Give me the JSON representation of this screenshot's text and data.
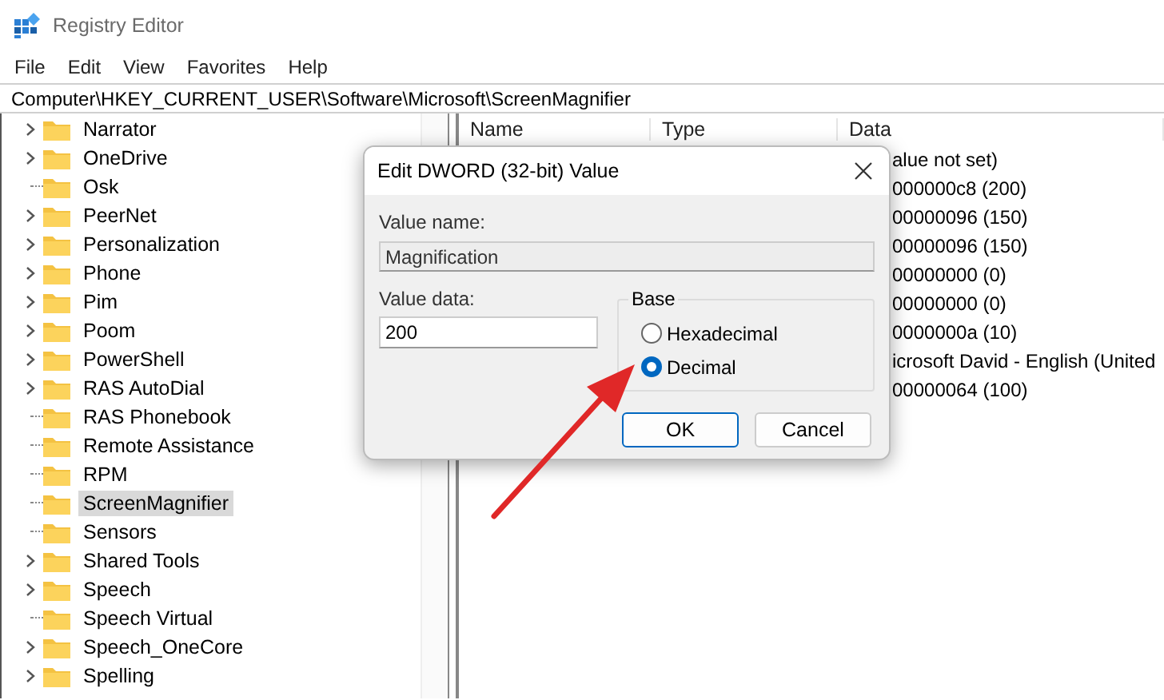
{
  "window": {
    "title": "Registry Editor"
  },
  "menu": [
    "File",
    "Edit",
    "View",
    "Favorites",
    "Help"
  ],
  "address": "Computer\\HKEY_CURRENT_USER\\Software\\Microsoft\\ScreenMagnifier",
  "tree": [
    {
      "label": "Narrator",
      "expandable": true,
      "selected": false
    },
    {
      "label": "OneDrive",
      "expandable": true,
      "selected": false
    },
    {
      "label": "Osk",
      "expandable": false,
      "selected": false
    },
    {
      "label": "PeerNet",
      "expandable": true,
      "selected": false
    },
    {
      "label": "Personalization",
      "expandable": true,
      "selected": false
    },
    {
      "label": "Phone",
      "expandable": true,
      "selected": false
    },
    {
      "label": "Pim",
      "expandable": true,
      "selected": false
    },
    {
      "label": "Poom",
      "expandable": true,
      "selected": false
    },
    {
      "label": "PowerShell",
      "expandable": true,
      "selected": false
    },
    {
      "label": "RAS AutoDial",
      "expandable": true,
      "selected": false
    },
    {
      "label": "RAS Phonebook",
      "expandable": false,
      "selected": false
    },
    {
      "label": "Remote Assistance",
      "expandable": false,
      "selected": false
    },
    {
      "label": "RPM",
      "expandable": false,
      "selected": false
    },
    {
      "label": "ScreenMagnifier",
      "expandable": false,
      "selected": true
    },
    {
      "label": "Sensors",
      "expandable": false,
      "selected": false
    },
    {
      "label": "Shared Tools",
      "expandable": true,
      "selected": false
    },
    {
      "label": "Speech",
      "expandable": true,
      "selected": false
    },
    {
      "label": "Speech Virtual",
      "expandable": false,
      "selected": false
    },
    {
      "label": "Speech_OneCore",
      "expandable": true,
      "selected": false
    },
    {
      "label": "Spelling",
      "expandable": true,
      "selected": false
    }
  ],
  "list": {
    "columns": [
      "Name",
      "Type",
      "Data"
    ],
    "rows": [
      {
        "data": "alue not set)"
      },
      {
        "data": "000000c8 (200)"
      },
      {
        "data": "00000096 (150)"
      },
      {
        "data": "00000096 (150)"
      },
      {
        "data": "00000000 (0)"
      },
      {
        "data": "00000000 (0)"
      },
      {
        "data": "0000000a (10)"
      },
      {
        "data": "icrosoft David - English (United"
      },
      {
        "data": "00000064 (100)"
      }
    ]
  },
  "dialog": {
    "title": "Edit DWORD (32-bit) Value",
    "value_name_label": "Value name:",
    "value_name": "Magnification",
    "value_data_label": "Value data:",
    "value_data": "200",
    "base_label": "Base",
    "radios": [
      {
        "label": "Hexadecimal",
        "selected": false
      },
      {
        "label": "Decimal",
        "selected": true
      }
    ],
    "buttons": [
      {
        "label": "OK",
        "default": true
      },
      {
        "label": "Cancel",
        "default": false
      }
    ]
  }
}
